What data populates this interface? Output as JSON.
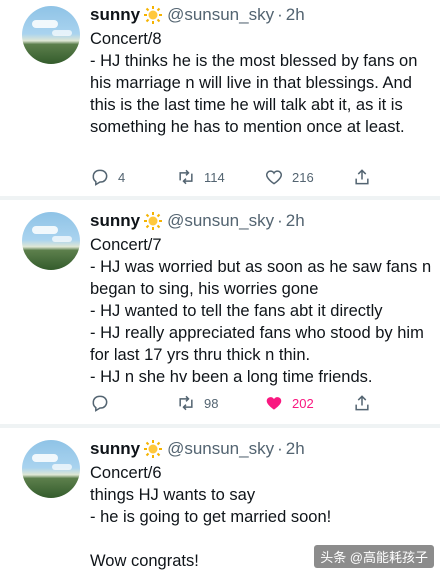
{
  "colors": {
    "accent_like": "#f91880",
    "secondary_text": "#536471",
    "separator": "#eff3f4"
  },
  "tweets": [
    {
      "name": "sunny",
      "emoji_icon": "sun-icon",
      "handle": "@sunsun_sky",
      "dot": "·",
      "time": "2h",
      "text": "Concert/8\n- HJ thinks he is the most blessed by fans on his marriage n will live in that blessings. And this is the last time he will talk abt it, as it is something he has to mention once at least.",
      "replies": "4",
      "retweets": "114",
      "likes": "216",
      "liked": false
    },
    {
      "name": "sunny",
      "emoji_icon": "sun-icon",
      "handle": "@sunsun_sky",
      "dot": "·",
      "time": "2h",
      "text": "Concert/7\n- HJ was worried but as soon as he saw fans n began to sing, his worries gone\n- HJ wanted to tell the fans abt it directly\n- HJ really appreciated fans who stood by him for last 17 yrs thru thick n thin.\n- HJ n she hv been a long time friends.",
      "replies": "",
      "retweets": "98",
      "likes": "202",
      "liked": true
    },
    {
      "name": "sunny",
      "emoji_icon": "sun-icon",
      "handle": "@sunsun_sky",
      "dot": "·",
      "time": "2h",
      "text": "Concert/6\nthings HJ wants to say\n- he is going to get married soon!\n\nWow congrats!"
    }
  ],
  "watermark": "头条 @高能耗孩子"
}
